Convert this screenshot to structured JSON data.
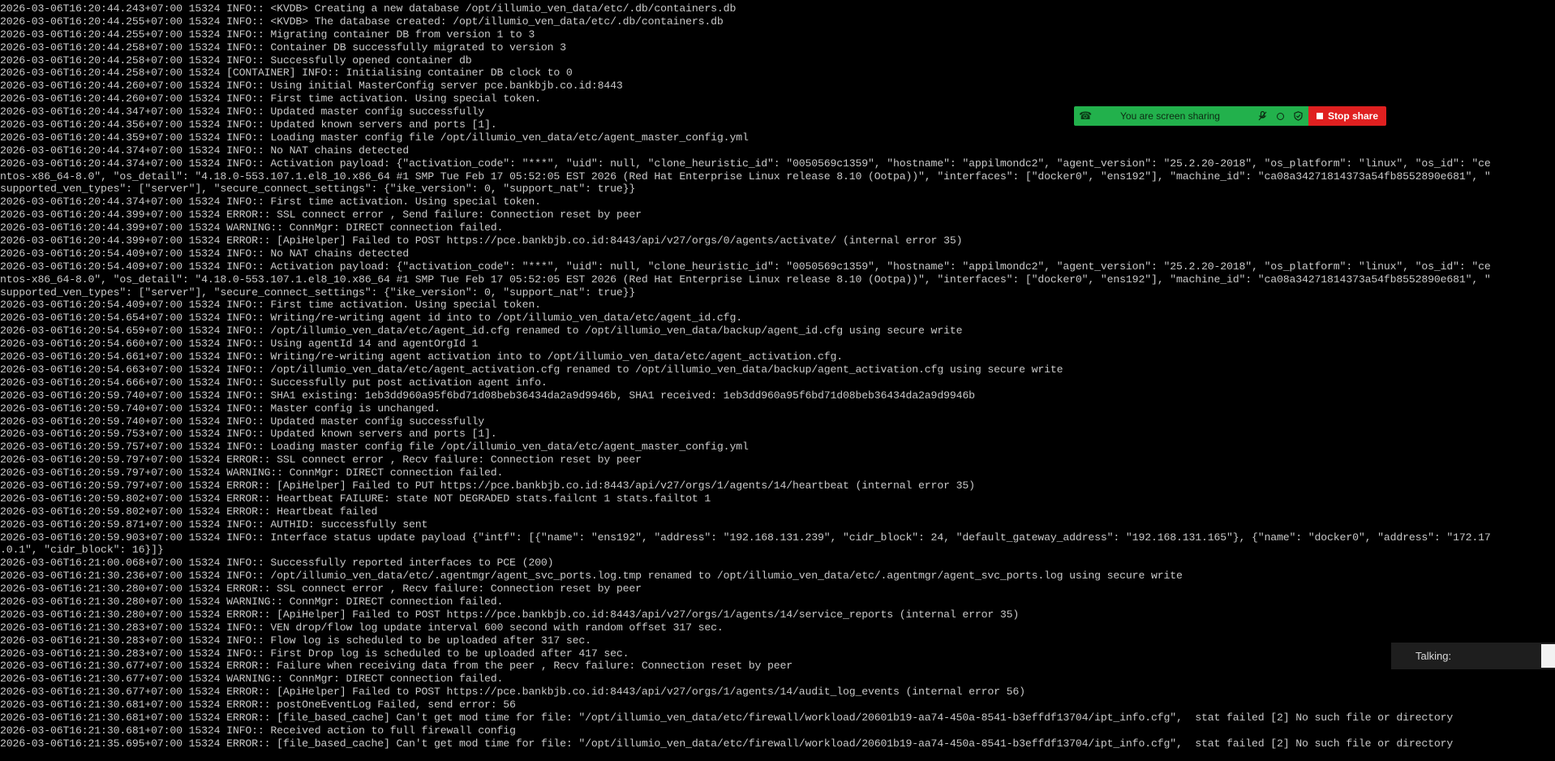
{
  "terminal": {
    "lines": [
      "2026-03-06T16:20:44.243+07:00 15324 INFO:: <KVDB> Creating a new database /opt/illumio_ven_data/etc/.db/containers.db",
      "2026-03-06T16:20:44.255+07:00 15324 INFO:: <KVDB> The database created: /opt/illumio_ven_data/etc/.db/containers.db",
      "2026-03-06T16:20:44.255+07:00 15324 INFO:: Migrating container DB from version 1 to 3",
      "2026-03-06T16:20:44.258+07:00 15324 INFO:: Container DB successfully migrated to version 3",
      "2026-03-06T16:20:44.258+07:00 15324 INFO:: Successfully opened container db",
      "2026-03-06T16:20:44.258+07:00 15324 [CONTAINER] INFO:: Initialising container DB clock to 0",
      "2026-03-06T16:20:44.260+07:00 15324 INFO:: Using initial MasterConfig server pce.bankbjb.co.id:8443",
      "2026-03-06T16:20:44.260+07:00 15324 INFO:: First time activation. Using special token.",
      "2026-03-06T16:20:44.347+07:00 15324 INFO:: Updated master config successfully",
      "2026-03-06T16:20:44.356+07:00 15324 INFO:: Updated known servers and ports [1].",
      "2026-03-06T16:20:44.359+07:00 15324 INFO:: Loading master config file /opt/illumio_ven_data/etc/agent_master_config.yml",
      "2026-03-06T16:20:44.374+07:00 15324 INFO:: No NAT chains detected",
      "2026-03-06T16:20:44.374+07:00 15324 INFO:: Activation payload: {\"activation_code\": \"***\", \"uid\": null, \"clone_heuristic_id\": \"0050569c1359\", \"hostname\": \"appilmondc2\", \"agent_version\": \"25.2.20-2018\", \"os_platform\": \"linux\", \"os_id\": \"ce",
      "ntos-x86_64-8.0\", \"os_detail\": \"4.18.0-553.107.1.el8_10.x86_64 #1 SMP Tue Feb 17 05:52:05 EST 2026 (Red Hat Enterprise Linux release 8.10 (Ootpa))\", \"interfaces\": [\"docker0\", \"ens192\"], \"machine_id\": \"ca08a34271814373a54fb8552890e681\", \"",
      "supported_ven_types\": [\"server\"], \"secure_connect_settings\": {\"ike_version\": 0, \"support_nat\": true}}",
      "2026-03-06T16:20:44.374+07:00 15324 INFO:: First time activation. Using special token.",
      "2026-03-06T16:20:44.399+07:00 15324 ERROR:: SSL connect error , Send failure: Connection reset by peer",
      "2026-03-06T16:20:44.399+07:00 15324 WARNING:: ConnMgr: DIRECT connection failed.",
      "2026-03-06T16:20:44.399+07:00 15324 ERROR:: [ApiHelper] Failed to POST https://pce.bankbjb.co.id:8443/api/v27/orgs/0/agents/activate/ (internal error 35)",
      "2026-03-06T16:20:54.409+07:00 15324 INFO:: No NAT chains detected",
      "2026-03-06T16:20:54.409+07:00 15324 INFO:: Activation payload: {\"activation_code\": \"***\", \"uid\": null, \"clone_heuristic_id\": \"0050569c1359\", \"hostname\": \"appilmondc2\", \"agent_version\": \"25.2.20-2018\", \"os_platform\": \"linux\", \"os_id\": \"ce",
      "ntos-x86_64-8.0\", \"os_detail\": \"4.18.0-553.107.1.el8_10.x86_64 #1 SMP Tue Feb 17 05:52:05 EST 2026 (Red Hat Enterprise Linux release 8.10 (Ootpa))\", \"interfaces\": [\"docker0\", \"ens192\"], \"machine_id\": \"ca08a34271814373a54fb8552890e681\", \"",
      "supported_ven_types\": [\"server\"], \"secure_connect_settings\": {\"ike_version\": 0, \"support_nat\": true}}",
      "2026-03-06T16:20:54.409+07:00 15324 INFO:: First time activation. Using special token.",
      "2026-03-06T16:20:54.654+07:00 15324 INFO:: Writing/re-writing agent id into to /opt/illumio_ven_data/etc/agent_id.cfg.",
      "2026-03-06T16:20:54.659+07:00 15324 INFO:: /opt/illumio_ven_data/etc/agent_id.cfg renamed to /opt/illumio_ven_data/backup/agent_id.cfg using secure write",
      "2026-03-06T16:20:54.660+07:00 15324 INFO:: Using agentId 14 and agentOrgId 1",
      "2026-03-06T16:20:54.661+07:00 15324 INFO:: Writing/re-writing agent activation into to /opt/illumio_ven_data/etc/agent_activation.cfg.",
      "2026-03-06T16:20:54.663+07:00 15324 INFO:: /opt/illumio_ven_data/etc/agent_activation.cfg renamed to /opt/illumio_ven_data/backup/agent_activation.cfg using secure write",
      "2026-03-06T16:20:54.666+07:00 15324 INFO:: Successfully put post activation agent info.",
      "2026-03-06T16:20:59.740+07:00 15324 INFO:: SHA1 existing: 1eb3dd960a95f6bd71d08beb36434da2a9d9946b, SHA1 received: 1eb3dd960a95f6bd71d08beb36434da2a9d9946b",
      "2026-03-06T16:20:59.740+07:00 15324 INFO:: Master config is unchanged.",
      "2026-03-06T16:20:59.740+07:00 15324 INFO:: Updated master config successfully",
      "2026-03-06T16:20:59.753+07:00 15324 INFO:: Updated known servers and ports [1].",
      "2026-03-06T16:20:59.757+07:00 15324 INFO:: Loading master config file /opt/illumio_ven_data/etc/agent_master_config.yml",
      "2026-03-06T16:20:59.797+07:00 15324 ERROR:: SSL connect error , Recv failure: Connection reset by peer",
      "2026-03-06T16:20:59.797+07:00 15324 WARNING:: ConnMgr: DIRECT connection failed.",
      "2026-03-06T16:20:59.797+07:00 15324 ERROR:: [ApiHelper] Failed to PUT https://pce.bankbjb.co.id:8443/api/v27/orgs/1/agents/14/heartbeat (internal error 35)",
      "2026-03-06T16:20:59.802+07:00 15324 ERROR:: Heartbeat FAILURE: state NOT DEGRADED stats.failcnt 1 stats.failtot 1",
      "2026-03-06T16:20:59.802+07:00 15324 ERROR:: Heartbeat failed",
      "2026-03-06T16:20:59.871+07:00 15324 INFO:: AUTHID: successfully sent",
      "2026-03-06T16:20:59.903+07:00 15324 INFO:: Interface status update payload {\"intf\": [{\"name\": \"ens192\", \"address\": \"192.168.131.239\", \"cidr_block\": 24, \"default_gateway_address\": \"192.168.131.165\"}, {\"name\": \"docker0\", \"address\": \"172.17",
      ".0.1\", \"cidr_block\": 16}]}",
      "2026-03-06T16:21:00.068+07:00 15324 INFO:: Successfully reported interfaces to PCE (200)",
      "2026-03-06T16:21:30.236+07:00 15324 INFO:: /opt/illumio_ven_data/etc/.agentmgr/agent_svc_ports.log.tmp renamed to /opt/illumio_ven_data/etc/.agentmgr/agent_svc_ports.log using secure write",
      "2026-03-06T16:21:30.280+07:00 15324 ERROR:: SSL connect error , Recv failure: Connection reset by peer",
      "2026-03-06T16:21:30.280+07:00 15324 WARNING:: ConnMgr: DIRECT connection failed.",
      "2026-03-06T16:21:30.280+07:00 15324 ERROR:: [ApiHelper] Failed to POST https://pce.bankbjb.co.id:8443/api/v27/orgs/1/agents/14/service_reports (internal error 35)",
      "2026-03-06T16:21:30.283+07:00 15324 INFO:: VEN drop/flow log update interval 600 second with random offset 317 sec.",
      "2026-03-06T16:21:30.283+07:00 15324 INFO:: Flow log is scheduled to be uploaded after 317 sec.",
      "2026-03-06T16:21:30.283+07:00 15324 INFO:: First Drop log is scheduled to be uploaded after 417 sec.",
      "2026-03-06T16:21:30.677+07:00 15324 ERROR:: Failure when receiving data from the peer , Recv failure: Connection reset by peer",
      "2026-03-06T16:21:30.677+07:00 15324 WARNING:: ConnMgr: DIRECT connection failed.",
      "2026-03-06T16:21:30.677+07:00 15324 ERROR:: [ApiHelper] Failed to POST https://pce.bankbjb.co.id:8443/api/v27/orgs/1/agents/14/audit_log_events (internal error 56)",
      "2026-03-06T16:21:30.681+07:00 15324 ERROR:: postOneEventLog Failed, send error: 56",
      "2026-03-06T16:21:30.681+07:00 15324 ERROR:: [file_based_cache] Can't get mod time for file: \"/opt/illumio_ven_data/etc/firewall/workload/20601b19-aa74-450a-8541-b3effdf13704/ipt_info.cfg\",  stat failed [2] No such file or directory",
      "2026-03-06T16:21:30.681+07:00 15324 INFO:: Received action to full firewall config",
      "2026-03-06T16:21:35.695+07:00 15324 ERROR:: [file_based_cache] Can't get mod time for file: \"/opt/illumio_ven_data/etc/firewall/workload/20601b19-aa74-450a-8541-b3effdf13704/ipt_info.cfg\",  stat failed [2] No such file or directory"
    ]
  },
  "screen_share": {
    "status_text": "You are screen sharing",
    "stop_label": "Stop share",
    "icons": [
      "drag-handle-icon",
      "microphone-muted-icon",
      "record-icon",
      "shield-icon",
      "stop-square-icon"
    ],
    "colors": {
      "bar": "#22b14c",
      "stop": "#e02020"
    }
  },
  "talking": {
    "label": "Talking:"
  },
  "colors": {
    "background": "#000000",
    "text": "#c8c8c8"
  }
}
